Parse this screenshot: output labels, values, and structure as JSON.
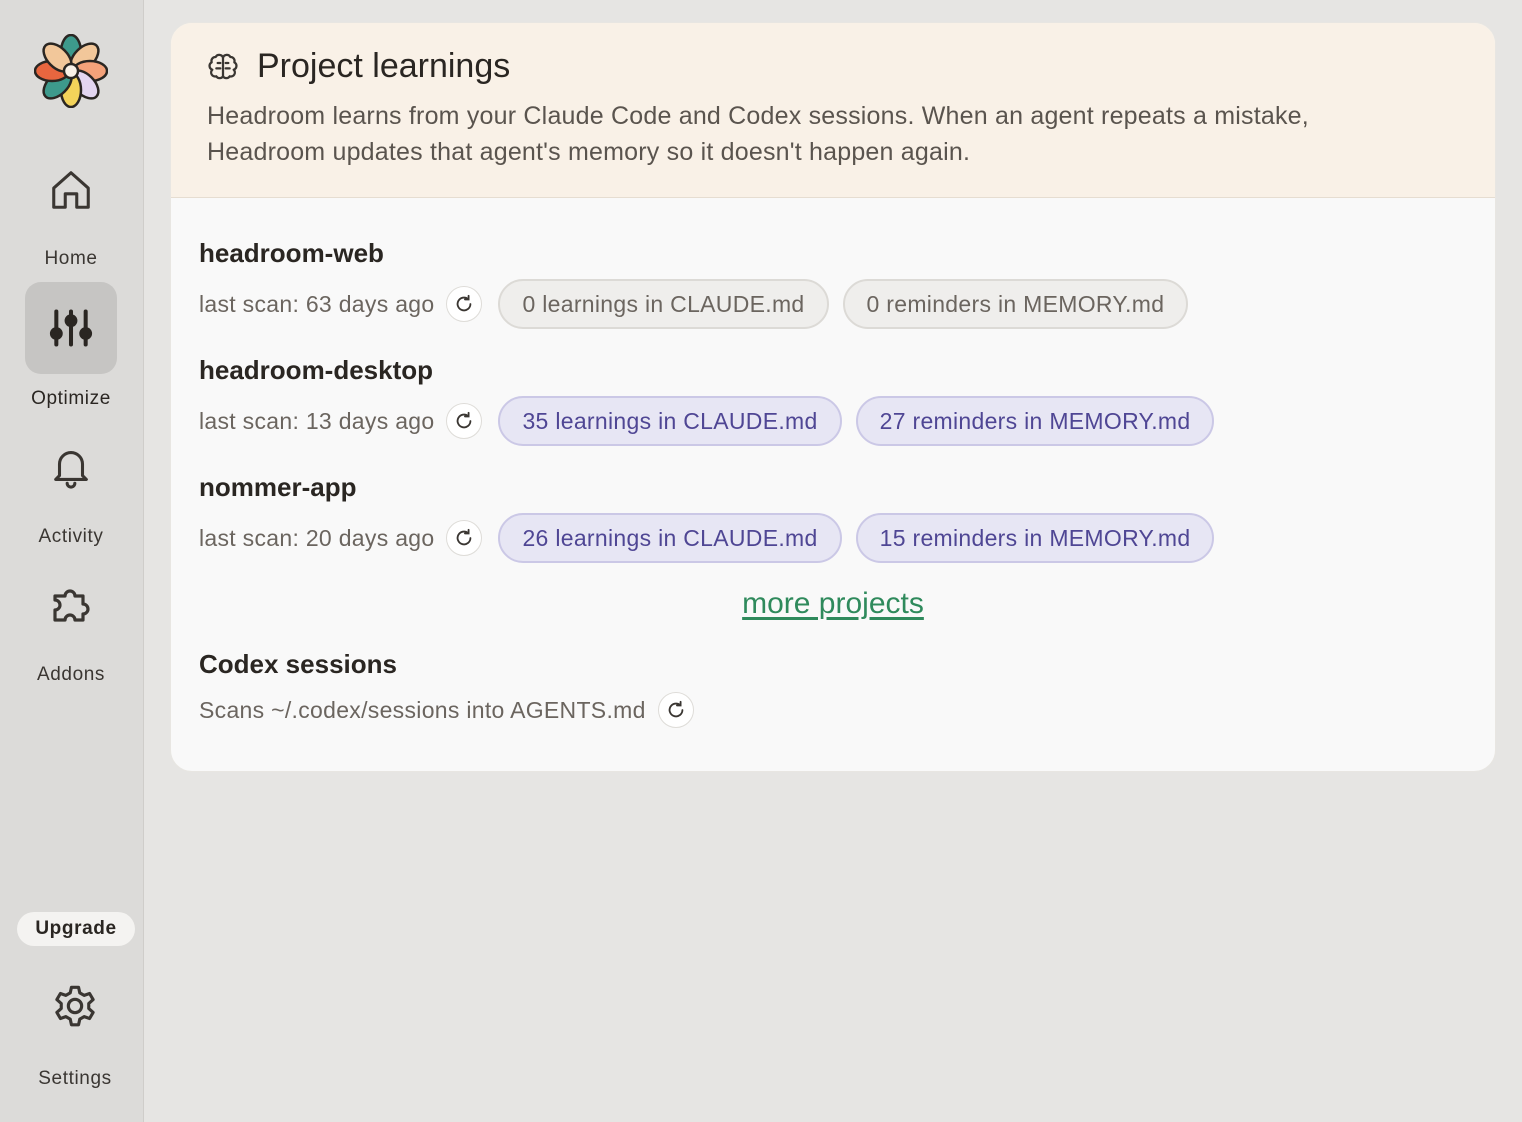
{
  "sidebar": {
    "items": [
      {
        "label": "Home",
        "icon": "home-icon"
      },
      {
        "label": "Optimize",
        "icon": "sliders-icon",
        "active": true
      },
      {
        "label": "Activity",
        "icon": "bell-icon"
      },
      {
        "label": "Addons",
        "icon": "puzzle-icon"
      }
    ],
    "upgrade_label": "Upgrade",
    "settings_label": "Settings"
  },
  "card": {
    "title": "Project learnings",
    "description_line1": "Headroom learns from your Claude Code and Codex sessions. When an agent repeats a mistake,",
    "description_line2": "Headroom updates that agent's memory so it doesn't happen again."
  },
  "projects": [
    {
      "name": "headroom-web",
      "last_scan": "last scan: 63 days ago",
      "learnings": "0 learnings in CLAUDE.md",
      "reminders": "0 reminders in MEMORY.md"
    },
    {
      "name": "headroom-desktop",
      "last_scan": "last scan: 13 days ago",
      "learnings": "35 learnings in CLAUDE.md",
      "reminders": "27 reminders in MEMORY.md"
    },
    {
      "name": "nommer-app",
      "last_scan": "last scan: 20 days ago",
      "learnings": "26 learnings in CLAUDE.md",
      "reminders": "15 reminders in MEMORY.md"
    }
  ],
  "more_projects_label": "more projects",
  "codex": {
    "title": "Codex sessions",
    "subtitle": "Scans ~/.codex/sessions into AGENTS.md"
  },
  "colors": {
    "accent_link": "#2f8a5c",
    "pill_text": "#4f4694",
    "header_bg": "#f9f1e7"
  }
}
